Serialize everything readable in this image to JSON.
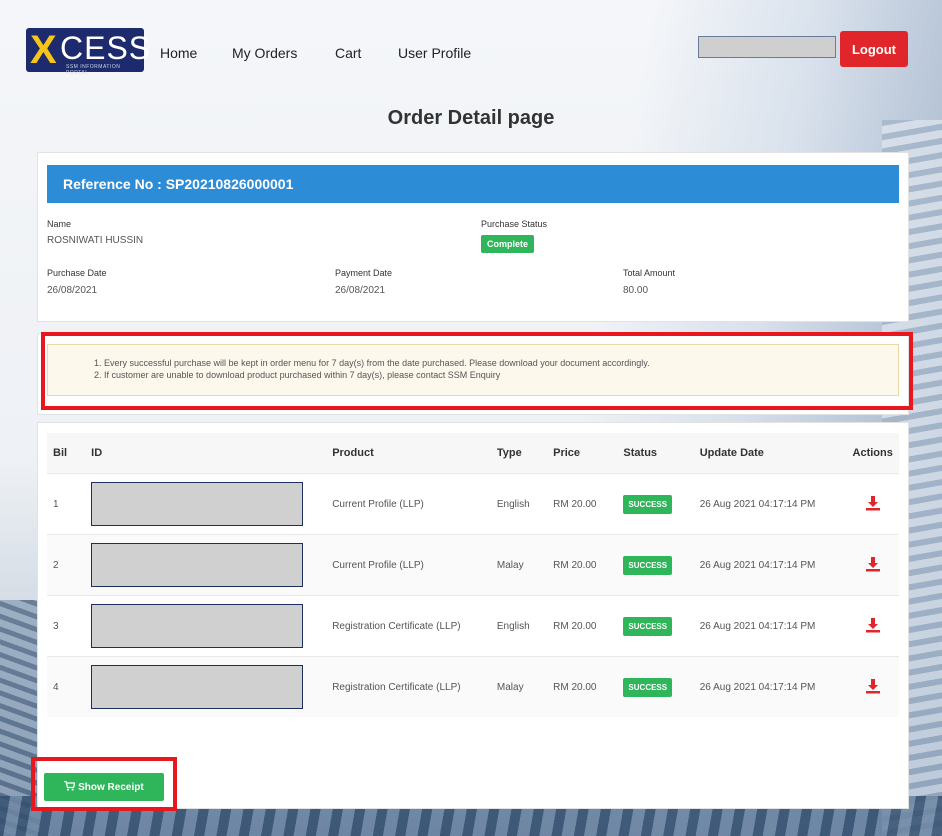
{
  "nav": {
    "logo_word": "CESS",
    "logo_x": "X",
    "logo_tag": "SSM INFORMATION PORTAL",
    "links": [
      "Home",
      "My Orders",
      "Cart",
      "User Profile"
    ],
    "logout_label": "Logout"
  },
  "page_title": "Order Detail page",
  "reference": {
    "header": "Reference No : SP20210826000001",
    "name_label": "Name",
    "name_value": "ROSNIWATI HUSSIN",
    "status_label": "Purchase Status",
    "status_value": "Complete",
    "purchase_date_label": "Purchase Date",
    "purchase_date_value": "26/08/2021",
    "payment_date_label": "Payment Date",
    "payment_date_value": "26/08/2021",
    "total_label": "Total Amount",
    "total_value": "80.00"
  },
  "notice": {
    "line1": "1. Every successful purchase will be kept in order menu for 7 day(s) from the date purchased. Please download your document accordingly.",
    "line2": "2. If customer are unable to download product purchased within 7 day(s), please contact SSM Enquiry"
  },
  "table": {
    "headers": [
      "Bil",
      "ID",
      "Product",
      "Type",
      "Price",
      "Status",
      "Update Date",
      "Actions"
    ],
    "rows": [
      {
        "bil": "1",
        "product": "Current Profile (LLP)",
        "type": "English",
        "price": "RM 20.00",
        "status": "SUCCESS",
        "date": "26 Aug 2021 04:17:14 PM"
      },
      {
        "bil": "2",
        "product": "Current Profile (LLP)",
        "type": "Malay",
        "price": "RM 20.00",
        "status": "SUCCESS",
        "date": "26 Aug 2021 04:17:14 PM"
      },
      {
        "bil": "3",
        "product": "Registration Certificate (LLP)",
        "type": "English",
        "price": "RM 20.00",
        "status": "SUCCESS",
        "date": "26 Aug 2021 04:17:14 PM"
      },
      {
        "bil": "4",
        "product": "Registration Certificate (LLP)",
        "type": "Malay",
        "price": "RM 20.00",
        "status": "SUCCESS",
        "date": "26 Aug 2021 04:17:14 PM"
      }
    ]
  },
  "receipt_button": "Show Receipt",
  "colors": {
    "primary_blue": "#2d8cd6",
    "success_green": "#2fb55a",
    "logout_red": "#e0262a",
    "download_red": "#e0262a"
  },
  "icons": {
    "download": "download-icon",
    "cart": "cart-icon"
  }
}
